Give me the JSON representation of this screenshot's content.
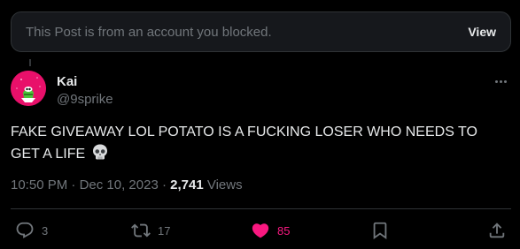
{
  "blocked_notice": {
    "text": "This Post is from an account you blocked.",
    "view_label": "View"
  },
  "author": {
    "name": "Kai",
    "handle": "@9sprike"
  },
  "tweet": {
    "text": "FAKE GIVEAWAY LOL POTATO IS A FUCKING LOSER WHO NEEDS TO GET A LIFE",
    "emoji_icon": "skull-icon"
  },
  "meta": {
    "time": "10:50 PM",
    "separator1": "·",
    "date": "Dec 10, 2023",
    "separator2": "·",
    "views_count": "2,741",
    "views_label": "Views"
  },
  "actions": {
    "replies": "3",
    "reposts": "17",
    "likes": "85"
  },
  "colors": {
    "background": "#000000",
    "card": "#16181c",
    "border": "#2f3336",
    "muted": "#71767b",
    "text": "#e7e9ea",
    "like": "#f91880",
    "avatar_bg": "#e8106a"
  }
}
